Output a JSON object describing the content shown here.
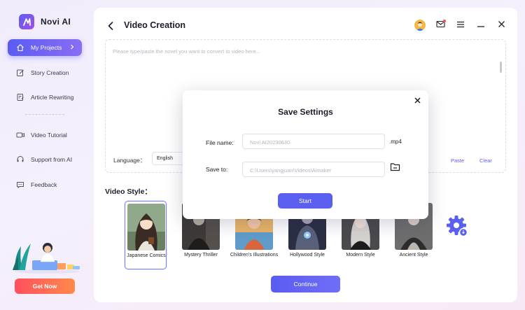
{
  "app": {
    "name": "Novi AI"
  },
  "sidebar": {
    "items": [
      {
        "label": "My Projects",
        "icon": "home-icon",
        "active": true
      },
      {
        "label": "Story Creation",
        "icon": "edit-icon"
      },
      {
        "label": "Article Rewriting",
        "icon": "document-edit-icon"
      },
      {
        "label": "Video Tutorial",
        "icon": "video-icon"
      },
      {
        "label": "Support from AI",
        "icon": "headset-icon"
      },
      {
        "label": "Feedback",
        "icon": "chat-icon"
      }
    ],
    "cta_label": "Get Now"
  },
  "header": {
    "title": "Video Creation"
  },
  "editor": {
    "placeholder": "Please type/paste the novel you want to convert to video here...",
    "language_label": "Language：",
    "language_value": "English",
    "paste_label": "Paste",
    "clear_label": "Clear"
  },
  "video_style": {
    "title": "Video Style：",
    "options": [
      {
        "label": "Japanese Comics",
        "selected": true
      },
      {
        "label": "Mystery Thriller"
      },
      {
        "label": "Children's Illustrations"
      },
      {
        "label": "Hollywood Style"
      },
      {
        "label": "Modern Style"
      },
      {
        "label": "Ancient Style"
      }
    ]
  },
  "continue_label": "Continue",
  "modal": {
    "title": "Save Settings",
    "file_name_label": "File name:",
    "file_name_value": "Novi AI20230630",
    "file_ext": ".mp4",
    "save_to_label": "Save to:",
    "save_to_value": "C:\\Users\\yangjuan\\Videos\\Aimaker",
    "start_label": "Start"
  },
  "colors": {
    "accent": "#5b5ff0",
    "cta_start": "#ff4f5e",
    "cta_end": "#ff8a4a"
  }
}
